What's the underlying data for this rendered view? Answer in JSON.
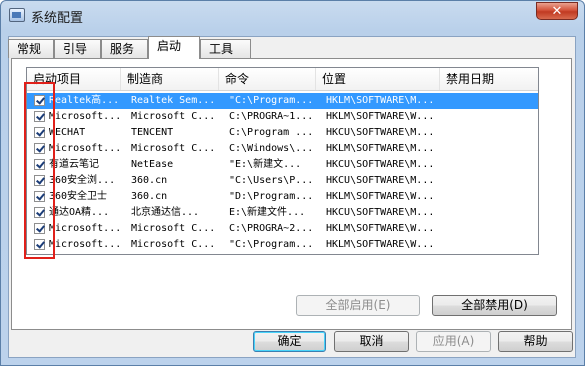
{
  "window": {
    "title": "系统配置",
    "close_label": "✕"
  },
  "tabs": [
    {
      "label": "常规",
      "active": false
    },
    {
      "label": "引导",
      "active": false
    },
    {
      "label": "服务",
      "active": false
    },
    {
      "label": "启动",
      "active": true
    },
    {
      "label": "工具",
      "active": false
    }
  ],
  "columns": [
    "启动项目",
    "制造商",
    "命令",
    "位置",
    "禁用日期"
  ],
  "rows": [
    {
      "item": "Realtek高...",
      "maker": "Realtek Sem...",
      "command": "\"C:\\Program...",
      "location": "HKLM\\SOFTWARE\\M...",
      "date": "",
      "checked": true,
      "selected": true
    },
    {
      "item": "Microsoft...",
      "maker": "Microsoft C...",
      "command": "C:\\PROGRA~1...",
      "location": "HKLM\\SOFTWARE\\W...",
      "date": "",
      "checked": true,
      "selected": false
    },
    {
      "item": "WECHAT",
      "maker": "TENCENT",
      "command": "C:\\Program ...",
      "location": "HKCU\\SOFTWARE\\M...",
      "date": "",
      "checked": true,
      "selected": false
    },
    {
      "item": "Microsoft...",
      "maker": "Microsoft C...",
      "command": "C:\\Windows\\...",
      "location": "HKLM\\SOFTWARE\\M...",
      "date": "",
      "checked": true,
      "selected": false
    },
    {
      "item": "有道云笔记",
      "maker": "NetEase",
      "command": "\"E:\\新建文...",
      "location": "HKCU\\SOFTWARE\\M...",
      "date": "",
      "checked": true,
      "selected": false
    },
    {
      "item": "360安全浏...",
      "maker": "360.cn",
      "command": "\"C:\\Users\\P...",
      "location": "HKCU\\SOFTWARE\\M...",
      "date": "",
      "checked": true,
      "selected": false
    },
    {
      "item": "360安全卫士",
      "maker": "360.cn",
      "command": "\"D:\\Program...",
      "location": "HKLM\\SOFTWARE\\W...",
      "date": "",
      "checked": true,
      "selected": false
    },
    {
      "item": "通达OA精...",
      "maker": "北京通达信...",
      "command": "E:\\新建文件...",
      "location": "HKCU\\SOFTWARE\\M...",
      "date": "",
      "checked": true,
      "selected": false
    },
    {
      "item": "Microsoft...",
      "maker": "Microsoft C...",
      "command": "C:\\PROGRA~2...",
      "location": "HKLM\\SOFTWARE\\W...",
      "date": "",
      "checked": true,
      "selected": false
    },
    {
      "item": "Microsoft...",
      "maker": "Microsoft C...",
      "command": "\"C:\\Program...",
      "location": "HKLM\\SOFTWARE\\W...",
      "date": "",
      "checked": true,
      "selected": false
    }
  ],
  "buttons": {
    "enable_all": "全部启用(E)",
    "disable_all": "全部禁用(D)",
    "ok": "确定",
    "cancel": "取消",
    "apply": "应用(A)",
    "help": "帮助"
  },
  "colors": {
    "selection": "#3399ff",
    "highlight_border": "#e0201a"
  }
}
